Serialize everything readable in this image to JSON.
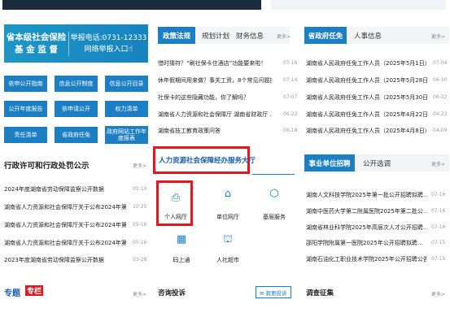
{
  "header_images": {
    "left": "",
    "right": ""
  },
  "banner": {
    "left_line1": "省本级社会保险",
    "left_line2": "基 金 监 督",
    "right_line1": "举报电话:0731-12333",
    "right_line2": "网络举报入口",
    "hand_icon": "pointing-hand-icon"
  },
  "quick_buttons": [
    [
      "依申公开指南",
      "信息公开制度",
      "信息公开目录"
    ],
    [
      "公开年度报告",
      "依申请公开",
      "权力清单"
    ],
    [
      "责任清单",
      "省政府任免",
      "政府网站工作年度报表"
    ]
  ],
  "permit": {
    "title": "行政许可和行政处罚公示",
    "more": "更多>",
    "items": [
      {
        "text": "2024年度湖南省劳动保障监察公开数据",
        "date": "05-10"
      },
      {
        "text": "湖南省人力资源和社会保障厅关于公布2024年第三季…",
        "date": "10-25"
      },
      {
        "text": "湖南省人力资源和社会保障厅关于公布2024年第一季…",
        "date": "05-16"
      },
      {
        "text": "湖南省人力资源和社会保障厅关于公布2024年第一季…",
        "date": "05-16"
      },
      {
        "text": "2023年度湖南省劳动保障监察公开数据",
        "date": "03-28"
      }
    ]
  },
  "policy": {
    "tabs": [
      "政策法规",
      "规划计划",
      "财务信息"
    ],
    "more": "更多>",
    "items": [
      {
        "text": "惜时猜符？“刷社保卡住酒店”功能要来啦！",
        "date": "07-16"
      },
      {
        "text": "休年假期间用来做？事关工资，8个常见问题提…",
        "date": "07-14"
      },
      {
        "text": "社保卡的这些隐藏功能，你了解吗？",
        "date": "07-07"
      },
      {
        "text": "湖南省人力资源和社会保障厅 湖南省财政厅 …",
        "date": "06-23"
      },
      {
        "text": "湖南省技工教育政策问答",
        "date": "06-18"
      }
    ]
  },
  "appoint": {
    "tabs": [
      "省政府任免",
      "人事信息"
    ],
    "more": "更多>",
    "items": [
      {
        "text": "湖南省人民政府任免工作人员（2025年5月1日）",
        "date": "07-04"
      },
      {
        "text": "湖南省人民政府任免工作人员（2025年5月28日）",
        "date": "06-30"
      },
      {
        "text": "湖南省人民政府任免工作人员（2025年5月30日）",
        "date": "06-22"
      },
      {
        "text": "湖南省人民政府任免工作人员（2025年4月22日）",
        "date": "04-23"
      },
      {
        "text": "湖南省人民政府任免工作人员（2025年4月8日）",
        "date": "04-09"
      }
    ]
  },
  "service": {
    "title": "人力资源社会保障经办服务大厅",
    "items": [
      {
        "label": "个人网厅",
        "icon": "personal-icon",
        "glyph": "⎙"
      },
      {
        "label": "单位网厅",
        "icon": "home-icon",
        "glyph": "⌂"
      },
      {
        "label": "基层服务",
        "icon": "grassroots-icon",
        "glyph": "⬡"
      },
      {
        "label": "码上通",
        "icon": "qrcode-icon",
        "glyph": "▦"
      },
      {
        "label": "人社超市",
        "icon": "market-icon",
        "glyph": "⛫"
      }
    ]
  },
  "recruit": {
    "tabs": [
      "事业单位招聘",
      "公开选调"
    ],
    "more": "更多>",
    "items": [
      {
        "text": "湖南人文科技学院2025年第一批公开招聘拟聘…",
        "date": "07-16"
      },
      {
        "text": "湖南中医药大学第二附属医院2025年第二批公…",
        "date": "07-16"
      },
      {
        "text": "湖南省林业科学院2025年高层次人才公开招聘…",
        "date": "07-16"
      },
      {
        "text": "邵阳学院附属第一医院2025年公开招聘拟聘…",
        "date": "07-15"
      },
      {
        "text": "湖南石油化工职业技术学院2025年公开招聘公告",
        "date": "07-15"
      }
    ]
  },
  "bottom": {
    "special_title": "专题",
    "special_badge": "专栏",
    "special_more": "更多>",
    "consult_title": "咨询投诉",
    "consult_btn": "我要投诉",
    "survey_title": "调查征集",
    "survey_more": "更多>"
  }
}
